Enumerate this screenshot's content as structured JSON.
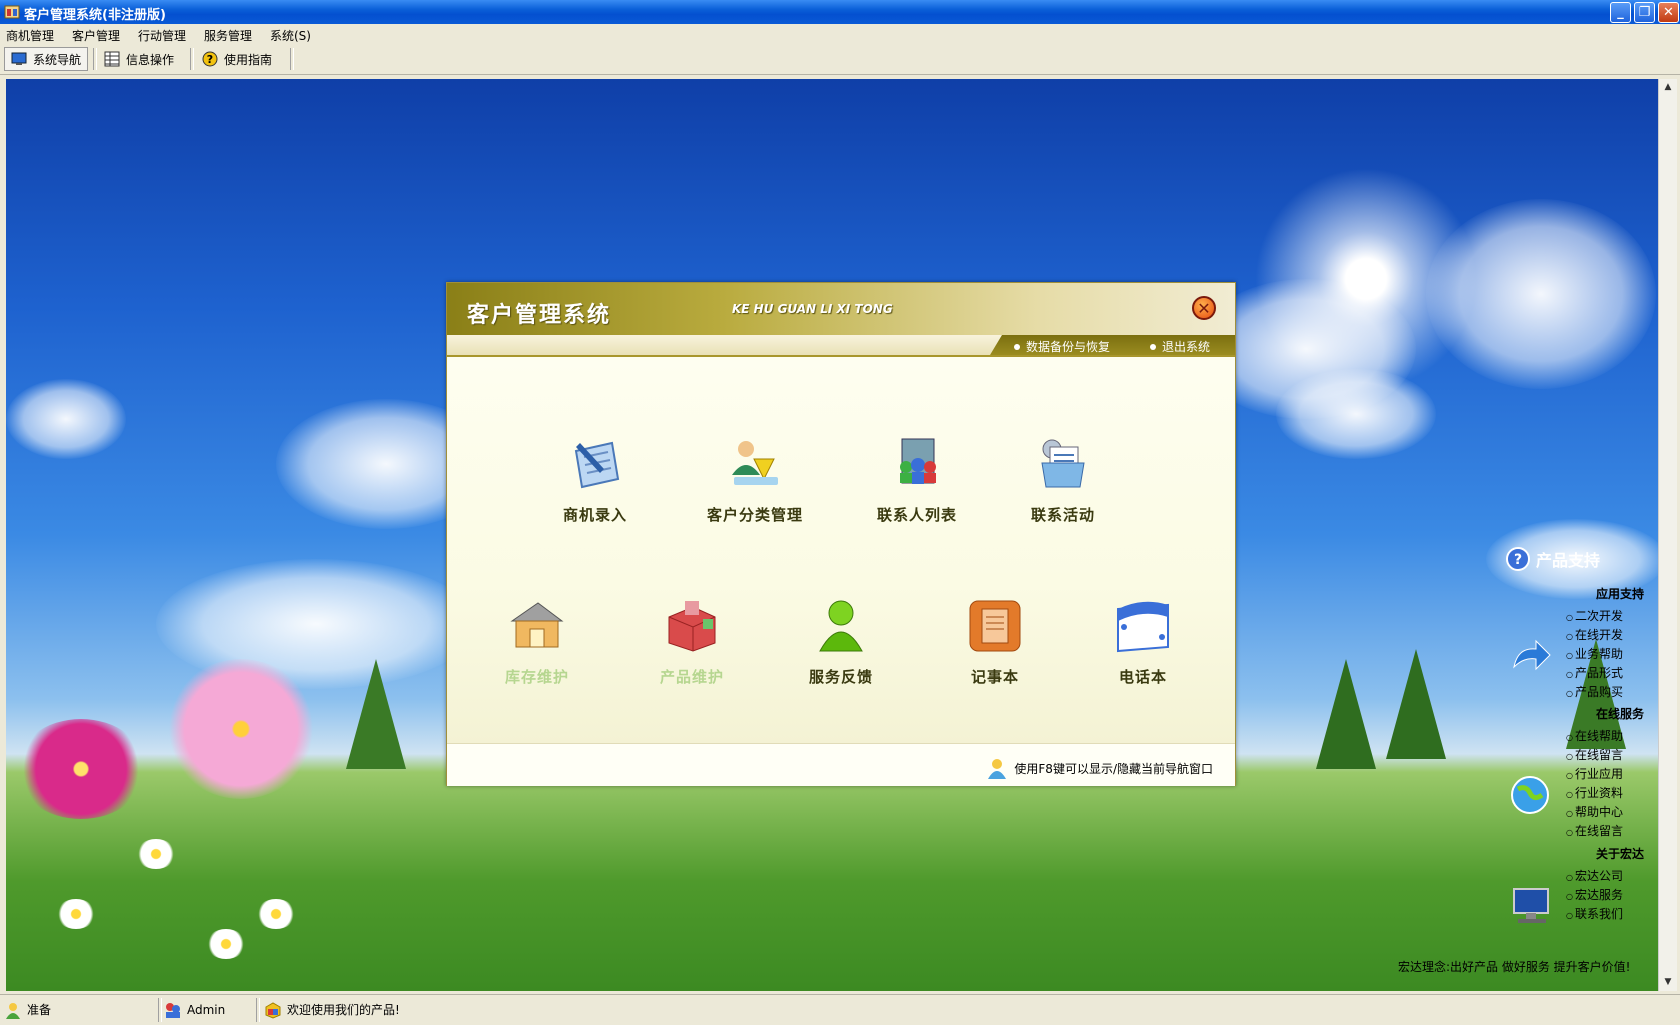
{
  "window": {
    "title": "客户管理系统(非注册版)",
    "minimize": "_",
    "maximize": "❐",
    "close": "✕"
  },
  "menu": [
    "商机管理",
    "客户管理",
    "行动管理",
    "服务管理",
    "系统(S)"
  ],
  "toolbar": {
    "nav": "系统导航",
    "info": "信息操作",
    "guide": "使用指南"
  },
  "dialog": {
    "title": "客户管理系统",
    "subtitle": "KE HU GUAN LI XI TONG",
    "close_glyph": "✕",
    "links": {
      "backup": "数据备份与恢复",
      "exit": "退出系统"
    },
    "row1": [
      "商机录入",
      "客户分类管理",
      "联系人列表",
      "联系活动"
    ],
    "row2": [
      "库存维护",
      "产品维护",
      "服务反馈",
      "记事本",
      "电话本"
    ],
    "hint": "使用F8键可以显示/隐藏当前导航窗口"
  },
  "support": {
    "title": "产品支持",
    "sections": [
      {
        "title": "应用支持",
        "links": [
          "二次开发",
          "在线开发",
          "业务帮助",
          "产品形式",
          "产品购买"
        ]
      },
      {
        "title": "在线服务",
        "links": [
          "在线帮助",
          "在线留言",
          "行业应用",
          "行业资料",
          "帮助中心",
          "在线留言"
        ]
      },
      {
        "title": "关于宏达",
        "links": [
          "宏达公司",
          "宏达服务",
          "联系我们"
        ]
      }
    ],
    "slogan": "宏达理念:出好产品 做好服务 提升客户价值!"
  },
  "status": {
    "ready": "准备",
    "user": "Admin",
    "message": "欢迎使用我们的产品!"
  },
  "colors": {
    "title_blue": "#0a5fd8",
    "dialog_gold": "#8a7f17",
    "label_dark": "#3a3a10",
    "disabled_green": "#b6d690"
  }
}
